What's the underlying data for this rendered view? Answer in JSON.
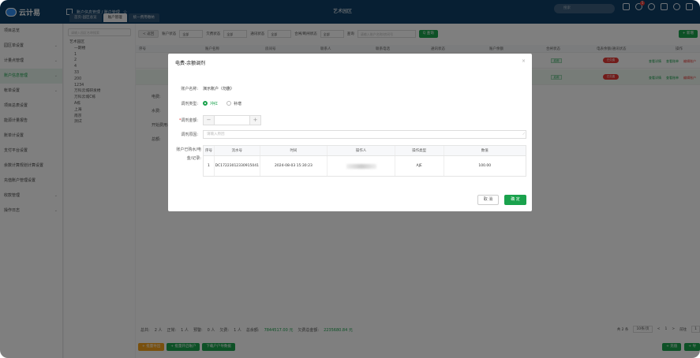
{
  "app": {
    "logo_text": "云计易",
    "page_center_title": "艺术园区"
  },
  "topbar": {
    "breadcrumb": "账户信息管理 / 账户管理",
    "star_icon": "star-icon",
    "search_placeholder": "搜索",
    "notification_count": "5"
  },
  "tabs": [
    {
      "label": "首页-园区总览",
      "active": false
    },
    {
      "label": "账户管理",
      "active": true
    },
    {
      "label": "统一费用缴纳",
      "active": false
    }
  ],
  "sidebar": {
    "items": [
      {
        "label": "项目总览",
        "active": false,
        "chevron": ""
      },
      {
        "label": "园区单设置",
        "active": false,
        "chevron": "⌄"
      },
      {
        "label": "计量点管理",
        "active": false,
        "chevron": "⌄"
      },
      {
        "label": "账户信息管理",
        "active": true,
        "chevron": "⌄"
      },
      {
        "label": "帐单设置",
        "active": false,
        "chevron": "⌄"
      },
      {
        "label": "项目总表设置",
        "active": false,
        "chevron": ""
      },
      {
        "label": "能源计量报告",
        "active": false,
        "chevron": ""
      },
      {
        "label": "账单计设置",
        "active": false,
        "chevron": ""
      },
      {
        "label": "支付平台设置",
        "active": false,
        "chevron": ""
      },
      {
        "label": "余数计算规划计算设置",
        "active": false,
        "chevron": ""
      },
      {
        "label": "充值账户管理设置",
        "active": false,
        "chevron": ""
      },
      {
        "label": "收款管理",
        "active": false,
        "chevron": "⌄"
      },
      {
        "label": "操作日志",
        "active": false,
        "chevron": "⌄"
      }
    ]
  },
  "tree": {
    "search_placeholder": "请输入园区名称搜索",
    "nodes": [
      "艺术园区",
      "一期楼",
      "1",
      "2",
      "4",
      "33",
      "200",
      "1234",
      "万科云城研发楼",
      "万科云城C栋",
      "A栋",
      "上海",
      "南京",
      "测试"
    ]
  },
  "filter": {
    "back_label": "< 返回",
    "account_status_label": "账户状态",
    "account_status_value": "全部",
    "arrear_label": "欠费状态",
    "arrear_value": "全部",
    "meter_label": "通讯状态",
    "meter_value": "全部",
    "relay_label": "合闸/断闸状态",
    "relay_value": "全部",
    "query_label": "查询",
    "query_placeholder": "请输入账户名称/房间号",
    "search_btn": "Q 查询",
    "right_btn": "+ 新增"
  },
  "table": {
    "headers": [
      "序号",
      "账户名称",
      "房间号",
      "联系人",
      "联系电话",
      "通讯状态",
      "账户余额",
      "合闸状态",
      "欠费状态",
      "电表余额/通讯状态",
      "操作"
    ],
    "rows": [
      {
        "status1": "启用",
        "status2": "已欠费",
        "ops": [
          "查看详情",
          "查看账单",
          "编辑账户"
        ]
      },
      {
        "status1": "启用",
        "status2": "已欠费",
        "ops": [
          "查看详情",
          "查看账单",
          "编辑账户"
        ]
      }
    ]
  },
  "detail_labels": [
    "电费:",
    "水费:",
    "开始费用:",
    "总额:"
  ],
  "summary": {
    "total_label": "总共:",
    "total_value": "2 人",
    "normal_label": "正常:",
    "normal_value": "1 人",
    "warn_label": "预警:",
    "warn_value": "0 人",
    "arrear_label": "欠费:",
    "arrear_value": "1 人",
    "balance_label": "总余额:",
    "balance_value": "7844517.00 元",
    "bill_label": "欠费总金额:",
    "bill_value": "2235680.84 元"
  },
  "pager": {
    "total": "共 2 条",
    "page_size": "10条/页",
    "prev": "<",
    "page": "1",
    "next": ">",
    "goto_label": "前往",
    "goto_value": "1"
  },
  "bottom_buttons": [
    "+ 批量导出",
    "+ 批量开启账户",
    "下载户户导数据"
  ],
  "bottom_right_buttons": [
    "+ 充值",
    "+ 导"
  ],
  "modal": {
    "title": "电费-余额调剂",
    "account_name_label": "账户名称:",
    "account_name_value": "演示账户（勿删）",
    "adjust_type_label": "调剂类型:",
    "option_deduct": "冲红",
    "option_supplement": "补增",
    "amount_label": "调剂金额:",
    "amount_required": "*",
    "stepper_minus": "−",
    "stepper_plus": "+",
    "reason_label": "调剂原因:",
    "reason_placeholder": "请输入原因",
    "records_label_line1": "账户已购水/电",
    "records_label_line2": "金/记录:",
    "records_headers": [
      "序号",
      "流水号",
      "时间",
      "操作人",
      "操作类型",
      "数值"
    ],
    "records_rows": [
      {
        "index": "1",
        "serial": "DC17223012330915041",
        "time": "2024-08-03 15:30:23",
        "operator": "",
        "type": "AJE",
        "value": "100.00"
      }
    ],
    "cancel_label": "取 消",
    "ok_label": "确 定"
  },
  "colors": {
    "primary": "#1aa24d",
    "header": "#0e3e66",
    "danger": "#e53935"
  }
}
